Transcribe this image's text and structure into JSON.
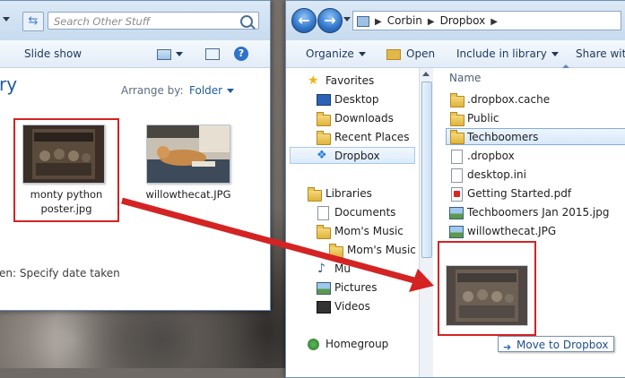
{
  "left_window": {
    "search_placeholder": "Search Other Stuff",
    "toolbar": {
      "slide_show": "Slide show"
    },
    "library_heading": "ry",
    "arrange_by_label": "Arrange by:",
    "arrange_by_value": "Folder",
    "files": [
      {
        "name_line1": "monty python",
        "name_line2": "poster.jpg",
        "highlighted": true
      },
      {
        "name_line1": "willowthecat.JPG",
        "name_line2": "",
        "highlighted": false
      }
    ],
    "status": "en:  Specify date taken"
  },
  "right_window": {
    "breadcrumb": [
      "Corbin",
      "Dropbox"
    ],
    "toolbar": {
      "organize": "Organize",
      "open": "Open",
      "include": "Include in library",
      "share": "Share with"
    },
    "nav": {
      "favorites_label": "Favorites",
      "favorites": [
        "Desktop",
        "Downloads",
        "Recent Places",
        "Dropbox"
      ],
      "libraries_label": "Libraries",
      "libraries": [
        "Documents",
        "Mom's Music",
        "Mom's Music (",
        "Mu",
        "Pictures",
        "Videos"
      ],
      "homegroup_label": "Homegroup",
      "selected": "Dropbox"
    },
    "column_name": "Name",
    "files": [
      {
        "name": ".dropbox.cache",
        "type": "folder"
      },
      {
        "name": "Public",
        "type": "folder"
      },
      {
        "name": "Techboomers",
        "type": "folder",
        "selected": true
      },
      {
        "name": ".dropbox",
        "type": "file"
      },
      {
        "name": "desktop.ini",
        "type": "file"
      },
      {
        "name": "Getting Started.pdf",
        "type": "pdf"
      },
      {
        "name": "Techboomers Jan 2015.jpg",
        "type": "image"
      },
      {
        "name": "willowthecat.JPG",
        "type": "image"
      }
    ],
    "drag_tooltip": "Move to Dropbox"
  },
  "annotation_color": "#d42323"
}
